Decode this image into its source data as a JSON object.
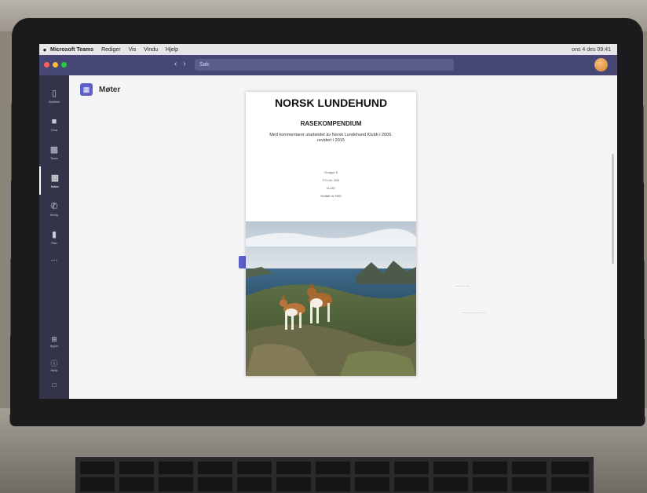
{
  "menubar": {
    "app_name": "Microsoft Teams",
    "items": [
      "Rediger",
      "Vis",
      "Vindu",
      "Hjelp"
    ],
    "status": "ons 4 des 09:41"
  },
  "titlebar": {
    "back_icon": "back-arrow-icon",
    "forward_icon": "forward-arrow-icon",
    "search_placeholder": "Søk"
  },
  "rail": {
    "items": [
      {
        "label": "Aktivitet",
        "icon": "bell-icon"
      },
      {
        "label": "Chat",
        "icon": "chat-icon"
      },
      {
        "label": "Team",
        "icon": "teams-icon"
      },
      {
        "label": "Møter",
        "icon": "calendar-icon",
        "active": true
      },
      {
        "label": "Anrop",
        "icon": "phone-icon"
      },
      {
        "label": "Filer",
        "icon": "file-icon"
      }
    ],
    "more": "...",
    "bottom": [
      {
        "label": "Apper",
        "icon": "apps-icon"
      },
      {
        "label": "Hjelp",
        "icon": "help-icon"
      }
    ]
  },
  "main": {
    "title": "Møter"
  },
  "document": {
    "title": "NORSK LUNDEHUND",
    "subtitle": "RASEKOMPENDIUM",
    "description": "Med kommentarer utarbeidet av Norsk Lundehund Klubb i 2009, revidert i 2015",
    "lines": [
      "Gruppe 5",
      "FCI-Nr. 265",
      "N-187",
      "Vedtatt av NKK"
    ]
  },
  "colors": {
    "teams_purple": "#464775",
    "rail": "#33344a",
    "accent": "#5b5fc7"
  }
}
